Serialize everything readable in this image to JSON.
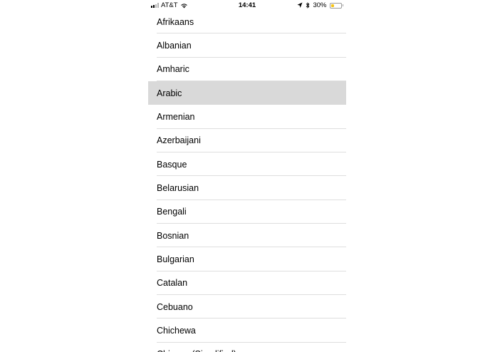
{
  "status_bar": {
    "carrier": "AT&T",
    "time": "14:41",
    "battery_percent": "30%",
    "battery_level": 0.3,
    "signal_bars_on": 2,
    "signal_bars_total": 4,
    "battery_color": "#f7c517"
  },
  "languages": {
    "selected": "Arabic",
    "items": [
      {
        "label": "Afrikaans"
      },
      {
        "label": "Albanian"
      },
      {
        "label": "Amharic"
      },
      {
        "label": "Arabic"
      },
      {
        "label": "Armenian"
      },
      {
        "label": "Azerbaijani"
      },
      {
        "label": "Basque"
      },
      {
        "label": "Belarusian"
      },
      {
        "label": "Bengali"
      },
      {
        "label": "Bosnian"
      },
      {
        "label": "Bulgarian"
      },
      {
        "label": "Catalan"
      },
      {
        "label": "Cebuano"
      },
      {
        "label": "Chichewa"
      },
      {
        "label": "Chinese (Simplified)"
      }
    ]
  },
  "colors": {
    "selected_row": "#d9d9d9",
    "separator": "#dedede"
  }
}
